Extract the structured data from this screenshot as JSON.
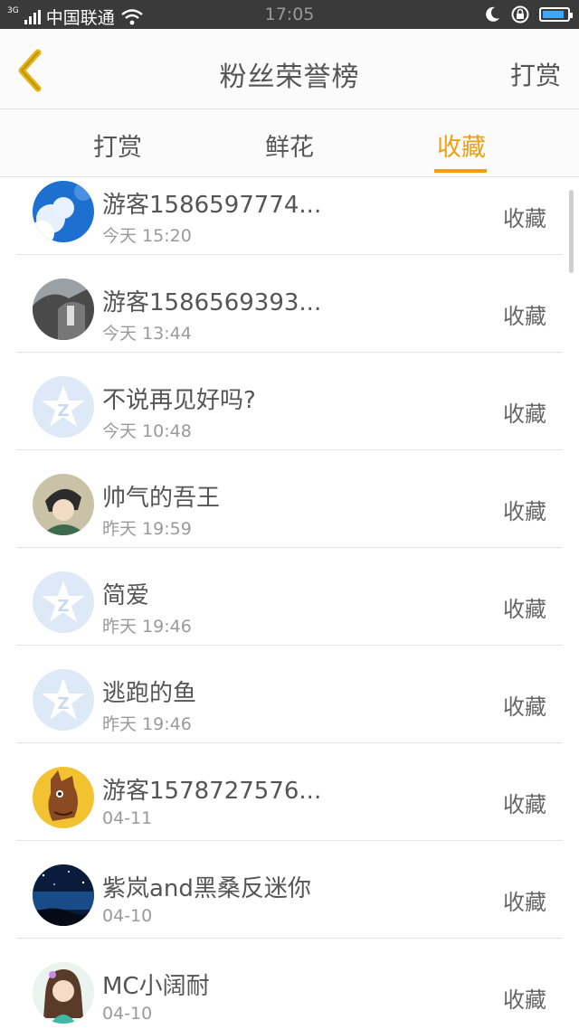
{
  "status_bar": {
    "network": "3G",
    "carrier": "中国联通",
    "time": "17:05",
    "icons": [
      "signal-icon",
      "wifi-icon",
      "moon-icon",
      "rotation-lock-icon",
      "battery-icon"
    ],
    "battery_level": 0.9
  },
  "header": {
    "title": "粉丝荣誉榜",
    "right_button": "打赏",
    "back_icon": "chevron-left-icon",
    "accent": "#f0a012"
  },
  "tabs": [
    {
      "label": "打赏",
      "active": false
    },
    {
      "label": "鲜花",
      "active": false
    },
    {
      "label": "收藏",
      "active": true
    }
  ],
  "rows": [
    {
      "name": "游客1586597774...",
      "time": "今天 15:20",
      "action": "收藏",
      "avatar": "sky-clouds"
    },
    {
      "name": "游客1586569393...",
      "time": "今天 13:44",
      "action": "收藏",
      "avatar": "rock-scene"
    },
    {
      "name": "不说再见好吗?",
      "time": "今天 10:48",
      "action": "收藏",
      "avatar": "default-qq-star"
    },
    {
      "name": "帅气的吾王",
      "time": "昨天 19:59",
      "action": "收藏",
      "avatar": "anime-character"
    },
    {
      "name": "简爱",
      "time": "昨天 19:46",
      "action": "收藏",
      "avatar": "default-qq-star"
    },
    {
      "name": "逃跑的鱼",
      "time": "昨天 19:46",
      "action": "收藏",
      "avatar": "default-qq-star"
    },
    {
      "name": "游客1578727576...",
      "time": "04-11",
      "action": "收藏",
      "avatar": "horse-cartoon"
    },
    {
      "name": "紫岚and黑桑反迷你",
      "time": "04-10",
      "action": "收藏",
      "avatar": "night-sky"
    },
    {
      "name": "MC小阔耐",
      "time": "04-10",
      "action": "收藏",
      "avatar": "anime-girl"
    }
  ]
}
